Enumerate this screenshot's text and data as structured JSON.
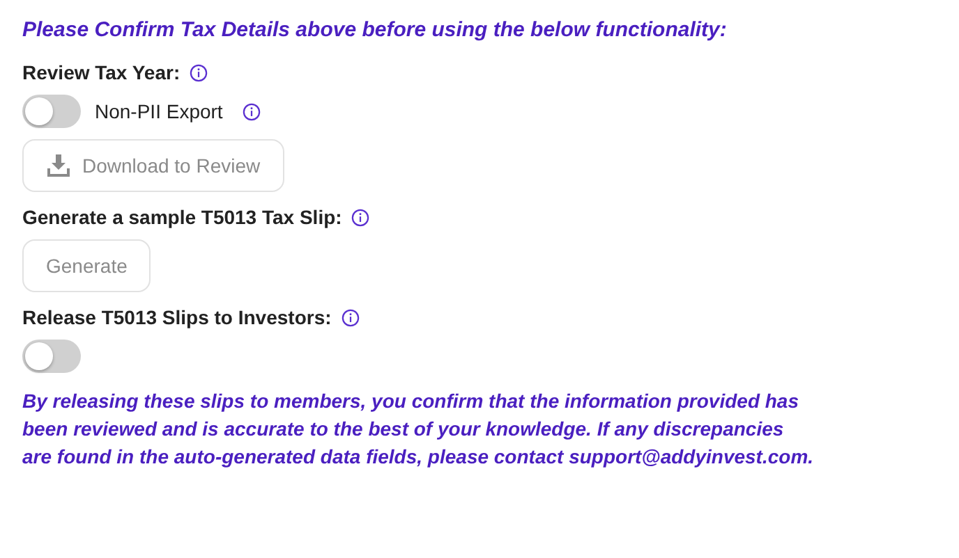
{
  "notice": "Please Confirm Tax Details above before using the below functionality:",
  "sections": [
    {
      "heading": "Review Tax Year:",
      "controls": [
        {
          "kind": "toggle",
          "label": "Non-PII Export",
          "on": false
        },
        {
          "kind": "download-button",
          "label": "Download to Review",
          "disabled": true
        }
      ]
    },
    {
      "heading": "Generate a sample T5013 Tax Slip:",
      "controls": [
        {
          "kind": "button",
          "label": "Generate",
          "disabled": true
        }
      ]
    },
    {
      "heading": "Release T5013 Slips to Investors:",
      "controls": [
        {
          "kind": "toggle",
          "on": false
        }
      ]
    }
  ],
  "disclaimer": "By releasing these slips to members, you confirm that the information provided has been reviewed and is accurate to the best of your knowledge. If any discrepancies are found in the auto-generated data fields, please contact support@addyinvest.com."
}
